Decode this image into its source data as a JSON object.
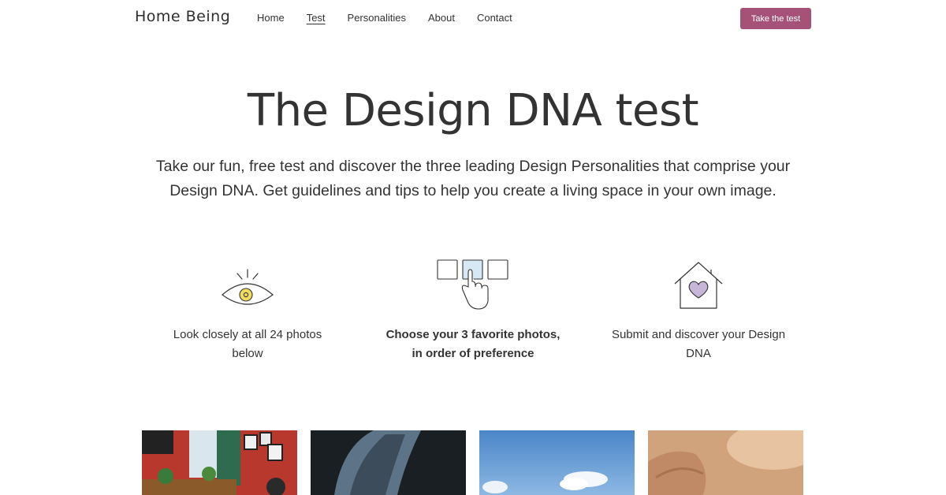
{
  "nav": {
    "brand": "Home Being",
    "links": [
      {
        "label": "Home",
        "active": false
      },
      {
        "label": "Test",
        "active": true
      },
      {
        "label": "Personalities",
        "active": false
      },
      {
        "label": "About",
        "active": false
      },
      {
        "label": "Contact",
        "active": false
      }
    ],
    "cta_label": "Take the test"
  },
  "hero": {
    "title": "The Design DNA test",
    "subtitle": "Take our fun, free test and discover the three leading Design Personalities that comprise your Design DNA. Get guidelines and tips to help you create a living space in your own image."
  },
  "steps": [
    {
      "icon": "eye-icon",
      "line1": "Look closely at all 24 photos",
      "line2": "below",
      "bold": false
    },
    {
      "icon": "photo-select-icon",
      "line1": "Choose your 3 favorite photos,",
      "line2": "in order of preference",
      "bold": true
    },
    {
      "icon": "house-heart-icon",
      "line1": "Submit and discover your Design",
      "line2": "DNA",
      "bold": false
    }
  ],
  "colors": {
    "accent": "#a65278",
    "text": "#333333",
    "highlight_yellow": "#f2dc5d",
    "highlight_blue": "#d7e8f5",
    "heart_purple": "#c8b6d8"
  }
}
